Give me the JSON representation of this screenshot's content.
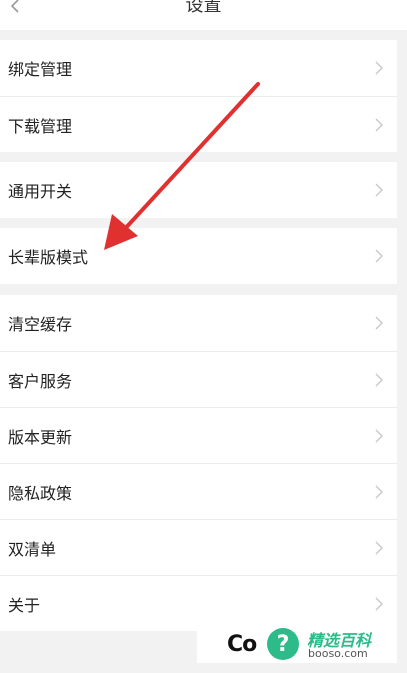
{
  "header": {
    "title": "设置"
  },
  "groups": [
    {
      "items": [
        {
          "label": "绑定管理"
        },
        {
          "label": "下载管理"
        }
      ]
    },
    {
      "items": [
        {
          "label": "通用开关"
        }
      ]
    },
    {
      "items": [
        {
          "label": "长辈版模式"
        }
      ]
    },
    {
      "items": [
        {
          "label": "清空缓存"
        },
        {
          "label": "客户服务"
        },
        {
          "label": "版本更新"
        },
        {
          "label": "隐私政策"
        },
        {
          "label": "双清单"
        },
        {
          "label": "关于"
        }
      ]
    }
  ],
  "annotation": {
    "color": "#e03030"
  },
  "watermark": {
    "text": "Co",
    "badge": "?",
    "brand": "精选百科",
    "site": "booso.com",
    "color": "#2dbb8a"
  }
}
